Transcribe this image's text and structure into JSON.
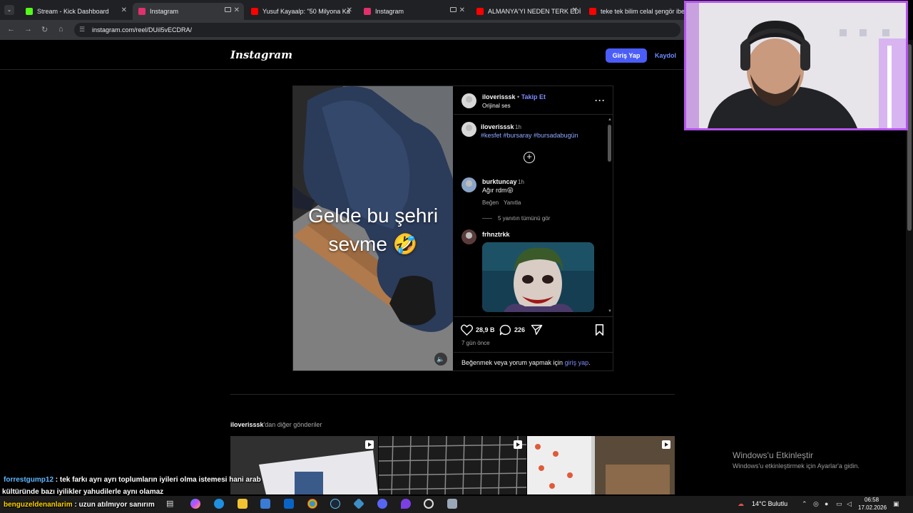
{
  "browser": {
    "tabs": [
      {
        "label": "Stream - Kick Dashboard",
        "favicon_color": "#53fc18",
        "active": false
      },
      {
        "label": "Instagram",
        "favicon_color": "#e1306c",
        "active": true
      },
      {
        "label": "Yusuf Kayaalp: \"50 Milyona Ka",
        "favicon_color": "#ff0000",
        "active": false
      },
      {
        "label": "Instagram",
        "favicon_color": "#e1306c",
        "active": false
      },
      {
        "label": "ALMANYA'YI NEDEN TERK EDİ",
        "favicon_color": "#ff0000",
        "active": false
      },
      {
        "label": "teke tek bilim celal şengör ibe",
        "favicon_color": "#ff0000",
        "active": false
      }
    ],
    "url": "instagram.com/reel/DUiI5vECDRA/"
  },
  "instagram": {
    "logo": "Instagram",
    "login_label": "Giriş Yap",
    "signup_label": "Kaydol",
    "post": {
      "author": "iloverisssk",
      "follow_sep": " • ",
      "follow_label": "Takip Et",
      "audio": "Orijinal ses",
      "video_caption_line1": "Gelde bu şehri",
      "video_caption_line2": "sevme 🤣",
      "caption_user": "iloverisssk",
      "caption_time": "1h",
      "caption_tags": "#kesfet #bursaray #bursadabugün",
      "comments": [
        {
          "user": "burktuncay",
          "time": "1h",
          "text": "Ağır rdm😝",
          "like": "Beğen",
          "reply": "Yanıtla",
          "view_replies": "5 yanıtın tümünü gör"
        },
        {
          "user": "frhnztrkk"
        }
      ],
      "likes": "28,9 B",
      "comment_count": "226",
      "posted": "7 gün önce",
      "login_prompt_prefix": "Beğenmek veya yorum yapmak için ",
      "login_prompt_link": "giriş yap",
      "login_prompt_suffix": "."
    },
    "more_posts_user": "iloverisssk",
    "more_posts_suffix": "'dan diğer gönderiler"
  },
  "windows": {
    "watermark_title": "Windows'u Etkinleştir",
    "watermark_sub": "Windows'u etkinleştirmek için Ayarlar'a gidin.",
    "weather": "14°C  Bulutlu",
    "time": "06:58",
    "date": "17.02.2026"
  },
  "chat": [
    {
      "user": "forrestgump12",
      "text": " : tek farkı ayrı ayrı toplumların iyileri olma istemesi hani arab"
    },
    {
      "user": "",
      "text": "kültüründe bazı iyilikler yahudilerle aynı olamaz"
    },
    {
      "user": "benguzeldenanlarim",
      "text": " : uzun atılmıyor sanırım"
    }
  ]
}
